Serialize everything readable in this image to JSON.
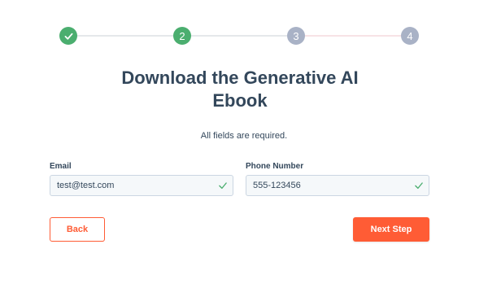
{
  "stepper": {
    "steps": [
      {
        "label": "",
        "state": "complete"
      },
      {
        "label": "2",
        "state": "active"
      },
      {
        "label": "3",
        "state": "upcoming"
      },
      {
        "label": "4",
        "state": "upcoming"
      }
    ]
  },
  "title": {
    "line1": "Download the Generative AI",
    "line2": "Ebook"
  },
  "subtitle": "All fields are required.",
  "form": {
    "email_label": "Email",
    "email_value": "test@test.com",
    "phone_label": "Phone Number",
    "phone_value": "555-123456"
  },
  "buttons": {
    "back_label": "Back",
    "next_label": "Next Step"
  },
  "colors": {
    "accent": "#ff5c35",
    "success": "#4bae6f",
    "pending": "#a9b2c6",
    "text": "#33475b"
  },
  "icons": {
    "step1": "checkmark-icon",
    "field_valid": "checkmark-icon"
  }
}
